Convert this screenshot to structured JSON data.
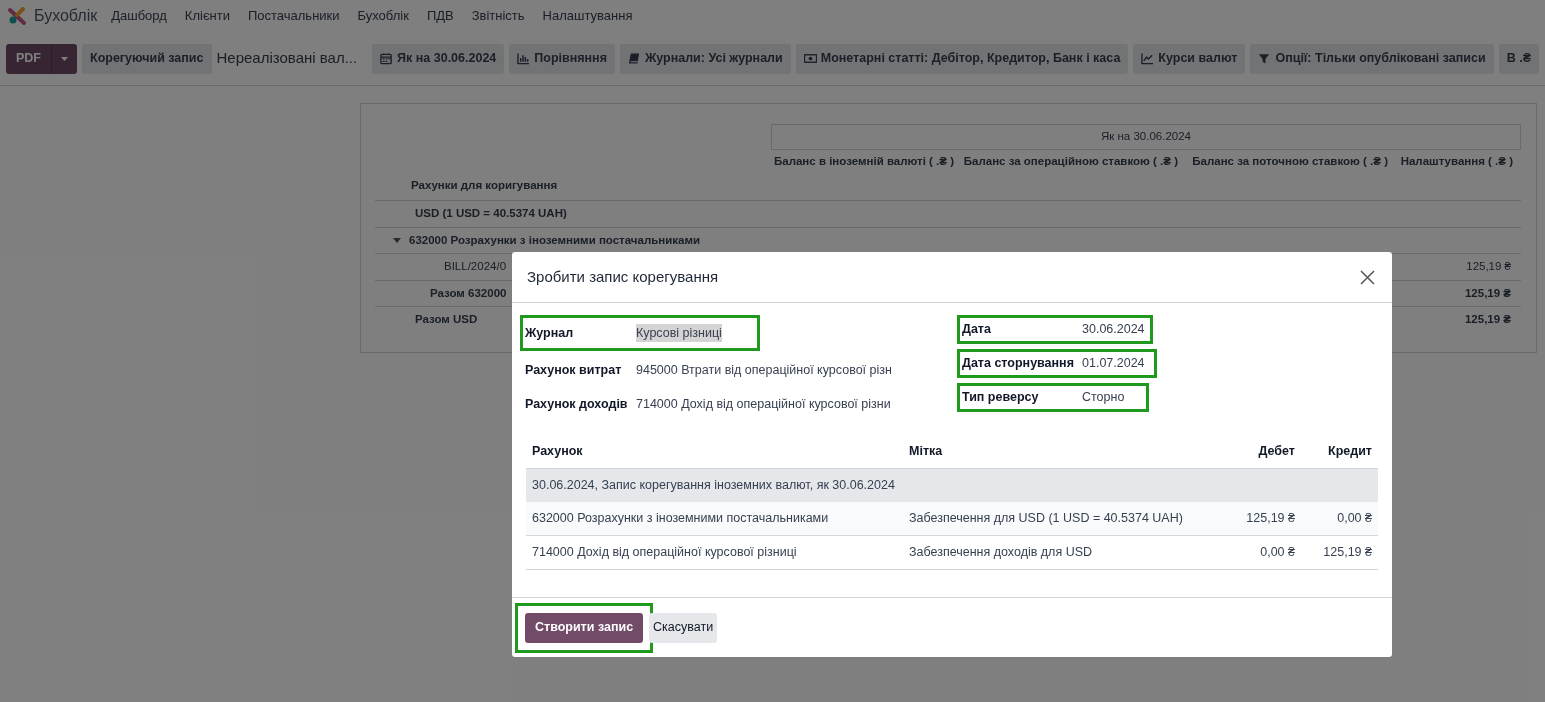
{
  "navbar": {
    "app_name": "Бухоблік",
    "menu": [
      "Дашборд",
      "Клієнти",
      "Постачальники",
      "Бухоблік",
      "ПДВ",
      "Звітність",
      "Налаштування"
    ]
  },
  "control_bar": {
    "pdf_button": "PDF",
    "adjust_button": "Корегуючий запис",
    "report_title": "Нереалізовані вал...",
    "filters": [
      {
        "kind": "calendar",
        "label": "Як на 30.06.2024"
      },
      {
        "kind": "chart",
        "label": "Порівняння"
      },
      {
        "kind": "book",
        "label": "Журнали: Усі журнали"
      },
      {
        "kind": "money",
        "label": "Монетарні статті: Дебітор, Кредитор, Банк і каса"
      },
      {
        "kind": "trend",
        "label": "Курси валют"
      },
      {
        "kind": "filter",
        "label": "Опції: Тільки опубліковані записи"
      },
      {
        "kind": "plain",
        "label": "В .₴"
      }
    ]
  },
  "report": {
    "period_header": "Як на 30.06.2024",
    "account_header": "Рахунки для коригування",
    "columns": [
      "Баланс в іноземній валюті ( .₴ )",
      "Баланс за операційною ставкою ( .₴ )",
      "Баланс за поточною ставкою ( .₴ )",
      "Налаштування ( .₴ )"
    ],
    "rows": [
      {
        "kind": "currency",
        "label": "USD (1 USD = 40.5374 UAH)",
        "value": ""
      },
      {
        "kind": "account",
        "label": "632000 Розрахунки з іноземними постачальниками",
        "expanded": true,
        "value": ""
      },
      {
        "kind": "line",
        "label": "BILL/2024/0",
        "value": "125,19 ₴"
      },
      {
        "kind": "subtotal",
        "label": "Разом 632000",
        "value": "125,19 ₴"
      },
      {
        "kind": "total",
        "label": "Разом USD",
        "value": "125,19 ₴"
      }
    ]
  },
  "dialog": {
    "title": "Зробити запис корегування",
    "left_fields": [
      {
        "label": "Журнал",
        "value": "Курсові різниці",
        "highlighted": true
      },
      {
        "label": "Рахунок витрат",
        "value": "945000 Втрати від операційної курсової різн",
        "highlighted": false
      },
      {
        "label": "Рахунок доходів",
        "value": "714000 Дохід від операційної курсової різни",
        "highlighted": false
      }
    ],
    "right_fields": [
      {
        "label": "Дата",
        "value": "30.06.2024",
        "highlighted": true
      },
      {
        "label": "Дата сторнування",
        "value": "01.07.2024",
        "highlighted": true
      },
      {
        "label": "Тип реверсу",
        "value": "Сторно",
        "highlighted": true
      }
    ],
    "table": {
      "columns": [
        "Рахунок",
        "Мітка",
        "Дебет",
        "Кредит"
      ],
      "group": "30.06.2024, Запис корегування іноземних валют, як 30.06.2024",
      "rows": [
        [
          "632000 Розрахунки з іноземними постачальниками",
          "Забезпечення для USD (1 USD = 40.5374 UAH)",
          "125,19 ₴",
          "0,00 ₴"
        ],
        [
          "714000 Дохід від операційної курсової різниці",
          "Забезпечення доходів для USD",
          "0,00 ₴",
          "125,19 ₴"
        ]
      ]
    },
    "create_button": {
      "label": "Створити запис",
      "highlighted": true
    },
    "cancel_button": "Скасувати"
  }
}
